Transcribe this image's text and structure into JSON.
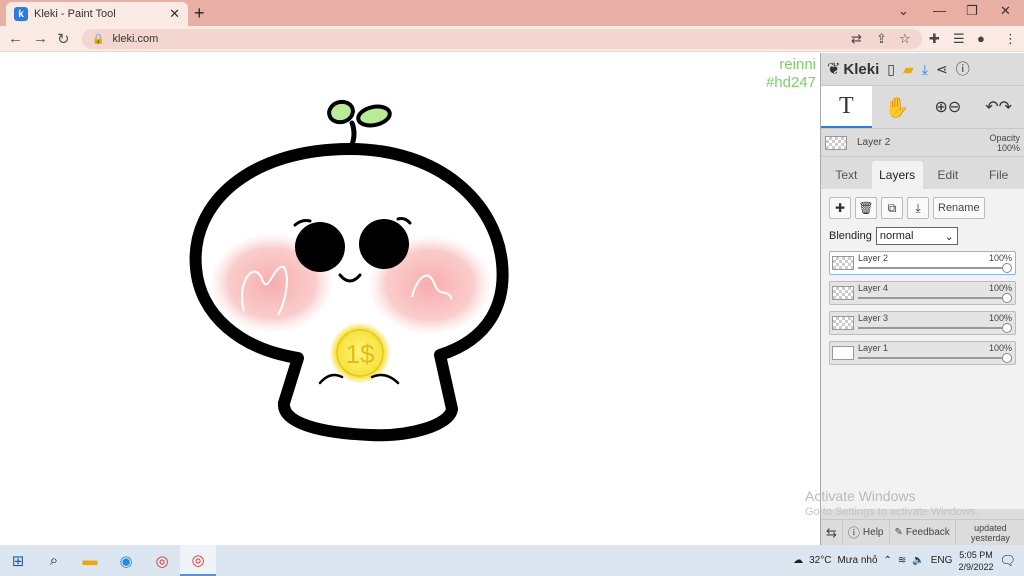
{
  "browser": {
    "tab_title": "Kleki - Paint Tool",
    "favicon_letter": "k",
    "url": "kleki.com"
  },
  "canvas": {
    "signature_line1": "reinni",
    "signature_line2": "#hd247",
    "coin_text": "1$",
    "watermark_title": "Activate Windows",
    "watermark_sub": "Go to Settings to activate Windows."
  },
  "sidebar": {
    "brand": "Kleki",
    "current_layer_name": "Layer 2",
    "opacity_label": "Opacity",
    "opacity_value": "100%",
    "tabs": [
      {
        "label": "Text"
      },
      {
        "label": "Layers"
      },
      {
        "label": "Edit"
      },
      {
        "label": "File"
      }
    ],
    "rename_label": "Rename",
    "blending_label": "Blending",
    "blending_value": "normal",
    "layers": [
      {
        "name": "Layer 2",
        "opacity": "100%"
      },
      {
        "name": "Layer 4",
        "opacity": "100%"
      },
      {
        "name": "Layer 3",
        "opacity": "100%"
      },
      {
        "name": "Layer 1",
        "opacity": "100%"
      }
    ],
    "help_label": "Help",
    "feedback_label": "Feedback",
    "updated_label": "updated yesterday"
  },
  "taskbar": {
    "temperature": "32°C",
    "weather": "Mưa nhỏ",
    "language": "ENG",
    "time": "5:05 PM",
    "date": "2/9/2022"
  }
}
